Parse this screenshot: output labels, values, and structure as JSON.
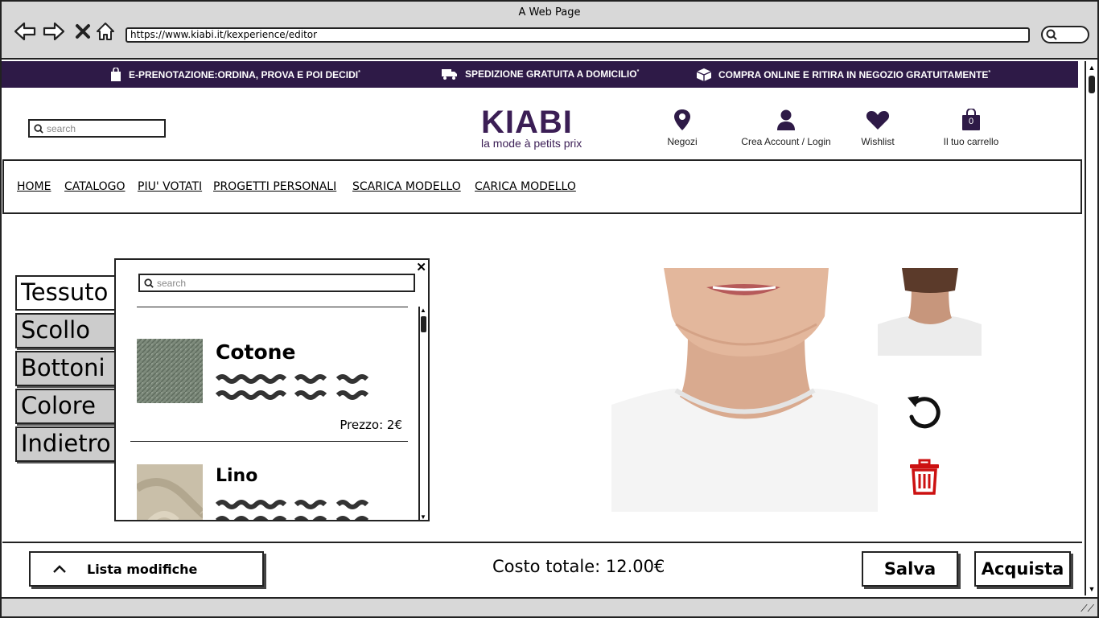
{
  "browser": {
    "window_title": "A Web Page",
    "url": "https://www.kiabi.it/kexperience/editor"
  },
  "promo": [
    {
      "icon": "shopping-bag-icon",
      "text": "E-PRENOTAZIONE:ORDINA, PROVA E POI DECIDI",
      "mark": "*"
    },
    {
      "icon": "truck-icon",
      "text": "SPEDIZIONE GRATUITA A DOMICILIO",
      "mark": "*"
    },
    {
      "icon": "package-icon",
      "text": "COMPRA ONLINE E RITIRA IN NEGOZIO GRATUITAMENTE",
      "mark": "*"
    }
  ],
  "header": {
    "search_placeholder": "search",
    "logo_main": "KIABI",
    "logo_sub": "la mode à petits prix",
    "actions": [
      {
        "icon": "map-pin-icon",
        "label": "Negozi"
      },
      {
        "icon": "user-icon",
        "label": "Crea Account / Login"
      },
      {
        "icon": "heart-icon",
        "label": "Wishlist"
      },
      {
        "icon": "cart-icon",
        "label": "Il tuo carrello",
        "badge": "0"
      }
    ]
  },
  "nav": [
    "HOME",
    "CATALOGO",
    "PIU' VOTATI",
    "PROGETTI PERSONALI",
    "SCARICA MODELLO",
    "CARICA MODELLO"
  ],
  "tabs": [
    "Tessuto",
    "Scollo",
    "Bottoni",
    "Colore",
    "Indietro"
  ],
  "active_tab": "Tessuto",
  "panel": {
    "close": "✕",
    "search_placeholder": "search",
    "items": [
      {
        "name": "Cotone",
        "price": "Prezzo: 2€",
        "swatch_color": "#7d8a7b"
      },
      {
        "name": "Lino",
        "price": "",
        "swatch_color": "#c9bfa9"
      }
    ]
  },
  "footer": {
    "list_label": "Lista modifiche",
    "total": "Costo totale: 12.00€",
    "save": "Salva",
    "buy": "Acquista"
  },
  "colors": {
    "brand": "#3b1e55",
    "promo_bg": "#2e1a47",
    "trash": "#cc1111"
  }
}
